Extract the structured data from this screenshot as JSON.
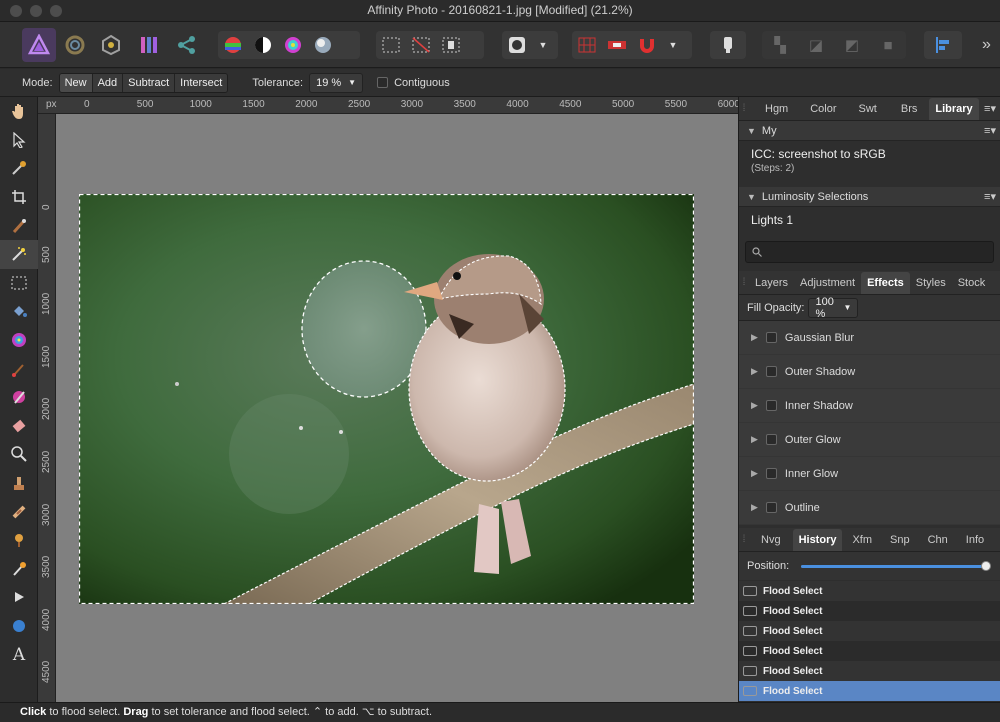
{
  "window": {
    "title": "Affinity Photo - 20160821-1.jpg [Modified] (21.2%)"
  },
  "context_toolbar": {
    "mode_label": "Mode:",
    "mode_options": [
      "New",
      "Add",
      "Subtract",
      "Intersect"
    ],
    "tolerance_label": "Tolerance:",
    "tolerance_value": "19 %",
    "contiguous_label": "Contiguous"
  },
  "ruler": {
    "unit": "px",
    "top_labels": [
      "0",
      "500",
      "1000",
      "1500",
      "2000",
      "2500",
      "3000",
      "3500",
      "4000",
      "4500",
      "5000",
      "5500",
      "6000"
    ],
    "left_labels": [
      "0",
      "500",
      "1000",
      "1500",
      "2000",
      "2500",
      "3000",
      "3500",
      "4000",
      "4500"
    ]
  },
  "panels": {
    "top_tabs": [
      "Hgm",
      "Color",
      "Swt",
      "Brs",
      "Library"
    ],
    "top_active": "Library",
    "library": {
      "section_my": "My",
      "item1_title": "ICC: screenshot to sRGB",
      "item1_steps": "(Steps: 2)",
      "section_lum": "Luminosity Selections",
      "item2_title": "Lights 1"
    },
    "mid_tabs": [
      "Layers",
      "Adjustment",
      "Effects",
      "Styles",
      "Stock"
    ],
    "mid_active": "Effects",
    "fill_opacity_label": "Fill Opacity:",
    "fill_opacity_value": "100 %",
    "effects": [
      "Gaussian Blur",
      "Outer Shadow",
      "Inner Shadow",
      "Outer Glow",
      "Inner Glow",
      "Outline"
    ],
    "bottom_tabs": [
      "Nvg",
      "History",
      "Xfm",
      "Snp",
      "Chn",
      "Info"
    ],
    "bottom_active": "History",
    "position_label": "Position:",
    "history_position": 1.0,
    "history": [
      "Flood Select",
      "Flood Select",
      "Flood Select",
      "Flood Select",
      "Flood Select",
      "Flood Select"
    ]
  },
  "status": {
    "click": "Click",
    "click_text": " to flood select. ",
    "drag": "Drag",
    "drag_text": " to set tolerance and flood select. ⌃ to add. ⌥ to subtract."
  }
}
